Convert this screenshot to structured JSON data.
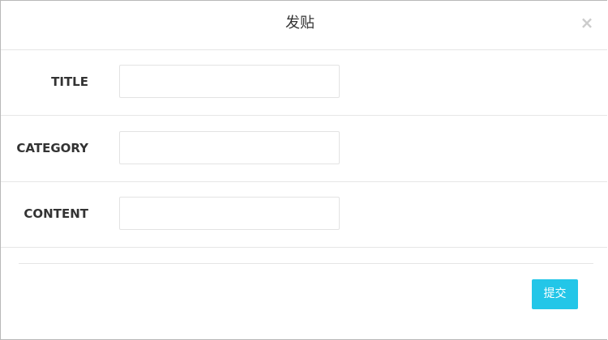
{
  "modal": {
    "title": "发贴",
    "close_symbol": "×"
  },
  "form": {
    "fields": [
      {
        "label": "TITLE",
        "value": "",
        "placeholder": ""
      },
      {
        "label": "CATEGORY",
        "value": "",
        "placeholder": ""
      },
      {
        "label": "CONTENT",
        "value": "",
        "placeholder": ""
      }
    ]
  },
  "footer": {
    "submit_label": "提交"
  },
  "colors": {
    "accent": "#23c6e8",
    "label_text": "#333333",
    "close_icon": "#cccccc",
    "border": "#e5e5e5"
  },
  "icons": {
    "close": "close-icon"
  }
}
